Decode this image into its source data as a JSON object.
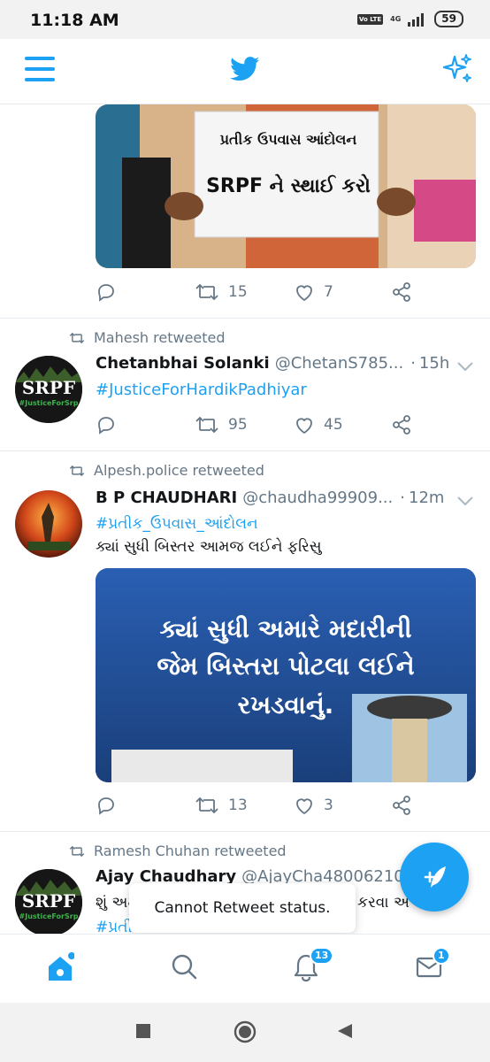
{
  "status_bar": {
    "time": "11:18 AM",
    "volte": "Vo LTE",
    "network": "4G",
    "battery": "59"
  },
  "app": {
    "accent": "#1da1f2"
  },
  "tweets": [
    {
      "stats": {
        "replies": "",
        "retweets": "15",
        "likes": "7"
      },
      "media_sign_lines": [
        "પ્રતીક ઉપવાસ આંદોલન",
        "SRPF ને સ્થાઈ કરો"
      ]
    },
    {
      "retweeted_by": "Mahesh retweeted",
      "name": "Chetanbhai Solanki",
      "handle": "@ChetanS785...",
      "dot": "·",
      "time": "15h",
      "hashtag": "#JusticeForHardikPadhiyar",
      "avatar_text": "SRPF",
      "avatar_sub": "#JusticeForSrp",
      "stats": {
        "retweets": "95",
        "likes": "45"
      }
    },
    {
      "retweeted_by": "Alpesh.police retweeted",
      "name": "B P CHAUDHARI",
      "handle": "@chaudha99909...",
      "dot": "·",
      "time": "12m",
      "hashtag": "#પ્રતીક_ઉપવાસ_આંદોલન",
      "text": "ક્યાં સુધી બિસ્તર આમજ લઈને ફરિસુ",
      "media_lines": [
        "ક્યાં સુધી અમારે મદારીની",
        "જેમ બિસ્તરા પોટલા લઈને",
        "રખડવાનું."
      ],
      "stats": {
        "retweets": "13",
        "likes": "3"
      }
    },
    {
      "retweeted_by": "Ramesh Chuhan retweeted",
      "name": "Ajay Chaudhary",
      "handle": "@AjayCha48006210",
      "text_start": "શું અમ",
      "text_end": "કરવા અ",
      "hashtag_partial": "#પ્રતીક",
      "avatar_text": "SRPF",
      "avatar_sub": "#JusticeForSrp"
    }
  ],
  "toast": "Cannot Retweet status.",
  "bottom_nav": {
    "notifications_badge": "13",
    "messages_badge": "1"
  }
}
